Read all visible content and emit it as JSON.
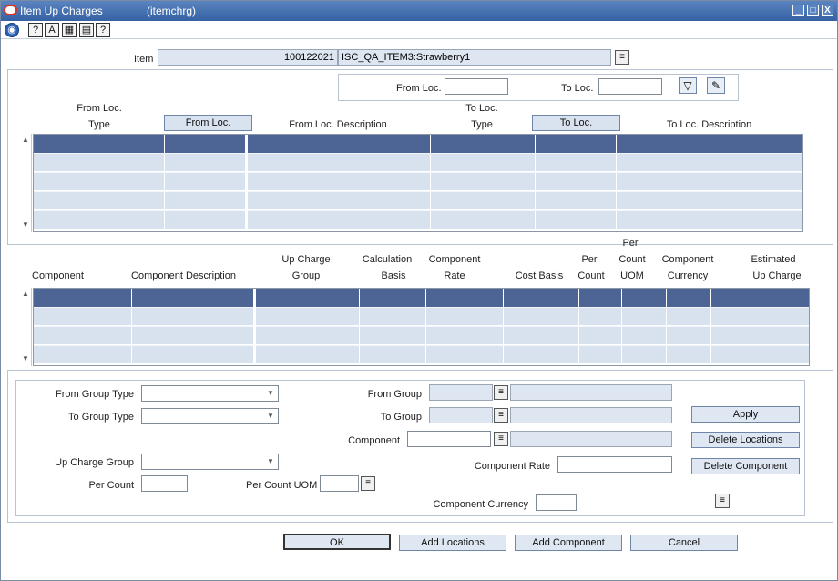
{
  "window": {
    "title": "Item Up Charges",
    "code": "(itemchrg)",
    "min_label": "_",
    "max_label": "□",
    "close_label": "X"
  },
  "item": {
    "label": "Item",
    "number": "100122021",
    "description": "ISC_QA_ITEM3:Strawberry1"
  },
  "filter": {
    "from_loc_label": "From Loc.",
    "to_loc_label": "To Loc.",
    "from_loc_value": "",
    "to_loc_value": ""
  },
  "locations_grid": {
    "headers": {
      "from_loc_type_1": "From Loc.",
      "from_loc_type_2": "Type",
      "from_loc_button": "From Loc.",
      "from_loc_desc": "From Loc. Description",
      "to_loc_type_1": "To Loc.",
      "to_loc_type_2": "Type",
      "to_loc_button": "To Loc.",
      "to_loc_desc": "To Loc. Description"
    }
  },
  "components_grid": {
    "headers": {
      "component": "Component",
      "component_desc": "Component Description",
      "up_charge_group_1": "Up Charge",
      "up_charge_group_2": "Group",
      "calc_basis_1": "Calculation",
      "calc_basis_2": "Basis",
      "comp_rate_1": "Component",
      "comp_rate_2": "Rate",
      "cost_basis": "Cost Basis",
      "per_count_1": "Per",
      "per_count_2": "Count",
      "per_count_uom_1": "Per",
      "per_count_uom_2": "Count",
      "per_count_uom_3": "UOM",
      "comp_currency_1": "Component",
      "comp_currency_2": "Currency",
      "est_up_charge_1": "Estimated",
      "est_up_charge_2": "Up Charge"
    }
  },
  "form": {
    "from_group_type": "From Group Type",
    "to_group_type": "To Group Type",
    "up_charge_group": "Up Charge Group",
    "per_count": "Per Count",
    "per_count_uom": "Per Count UOM",
    "from_group": "From Group",
    "to_group": "To Group",
    "component": "Component",
    "component_rate": "Component Rate",
    "component_currency": "Component Currency",
    "apply": "Apply",
    "delete_locations": "Delete Locations",
    "delete_component": "Delete Component"
  },
  "footer": {
    "ok": "OK",
    "add_locations": "Add Locations",
    "add_component": "Add Component",
    "cancel": "Cancel"
  },
  "colors": {
    "title_bar": "#3d6aa8",
    "grid_header": "#4d6595",
    "grid_row": "#d8e1ee",
    "readonly_field": "#dde6f1"
  }
}
